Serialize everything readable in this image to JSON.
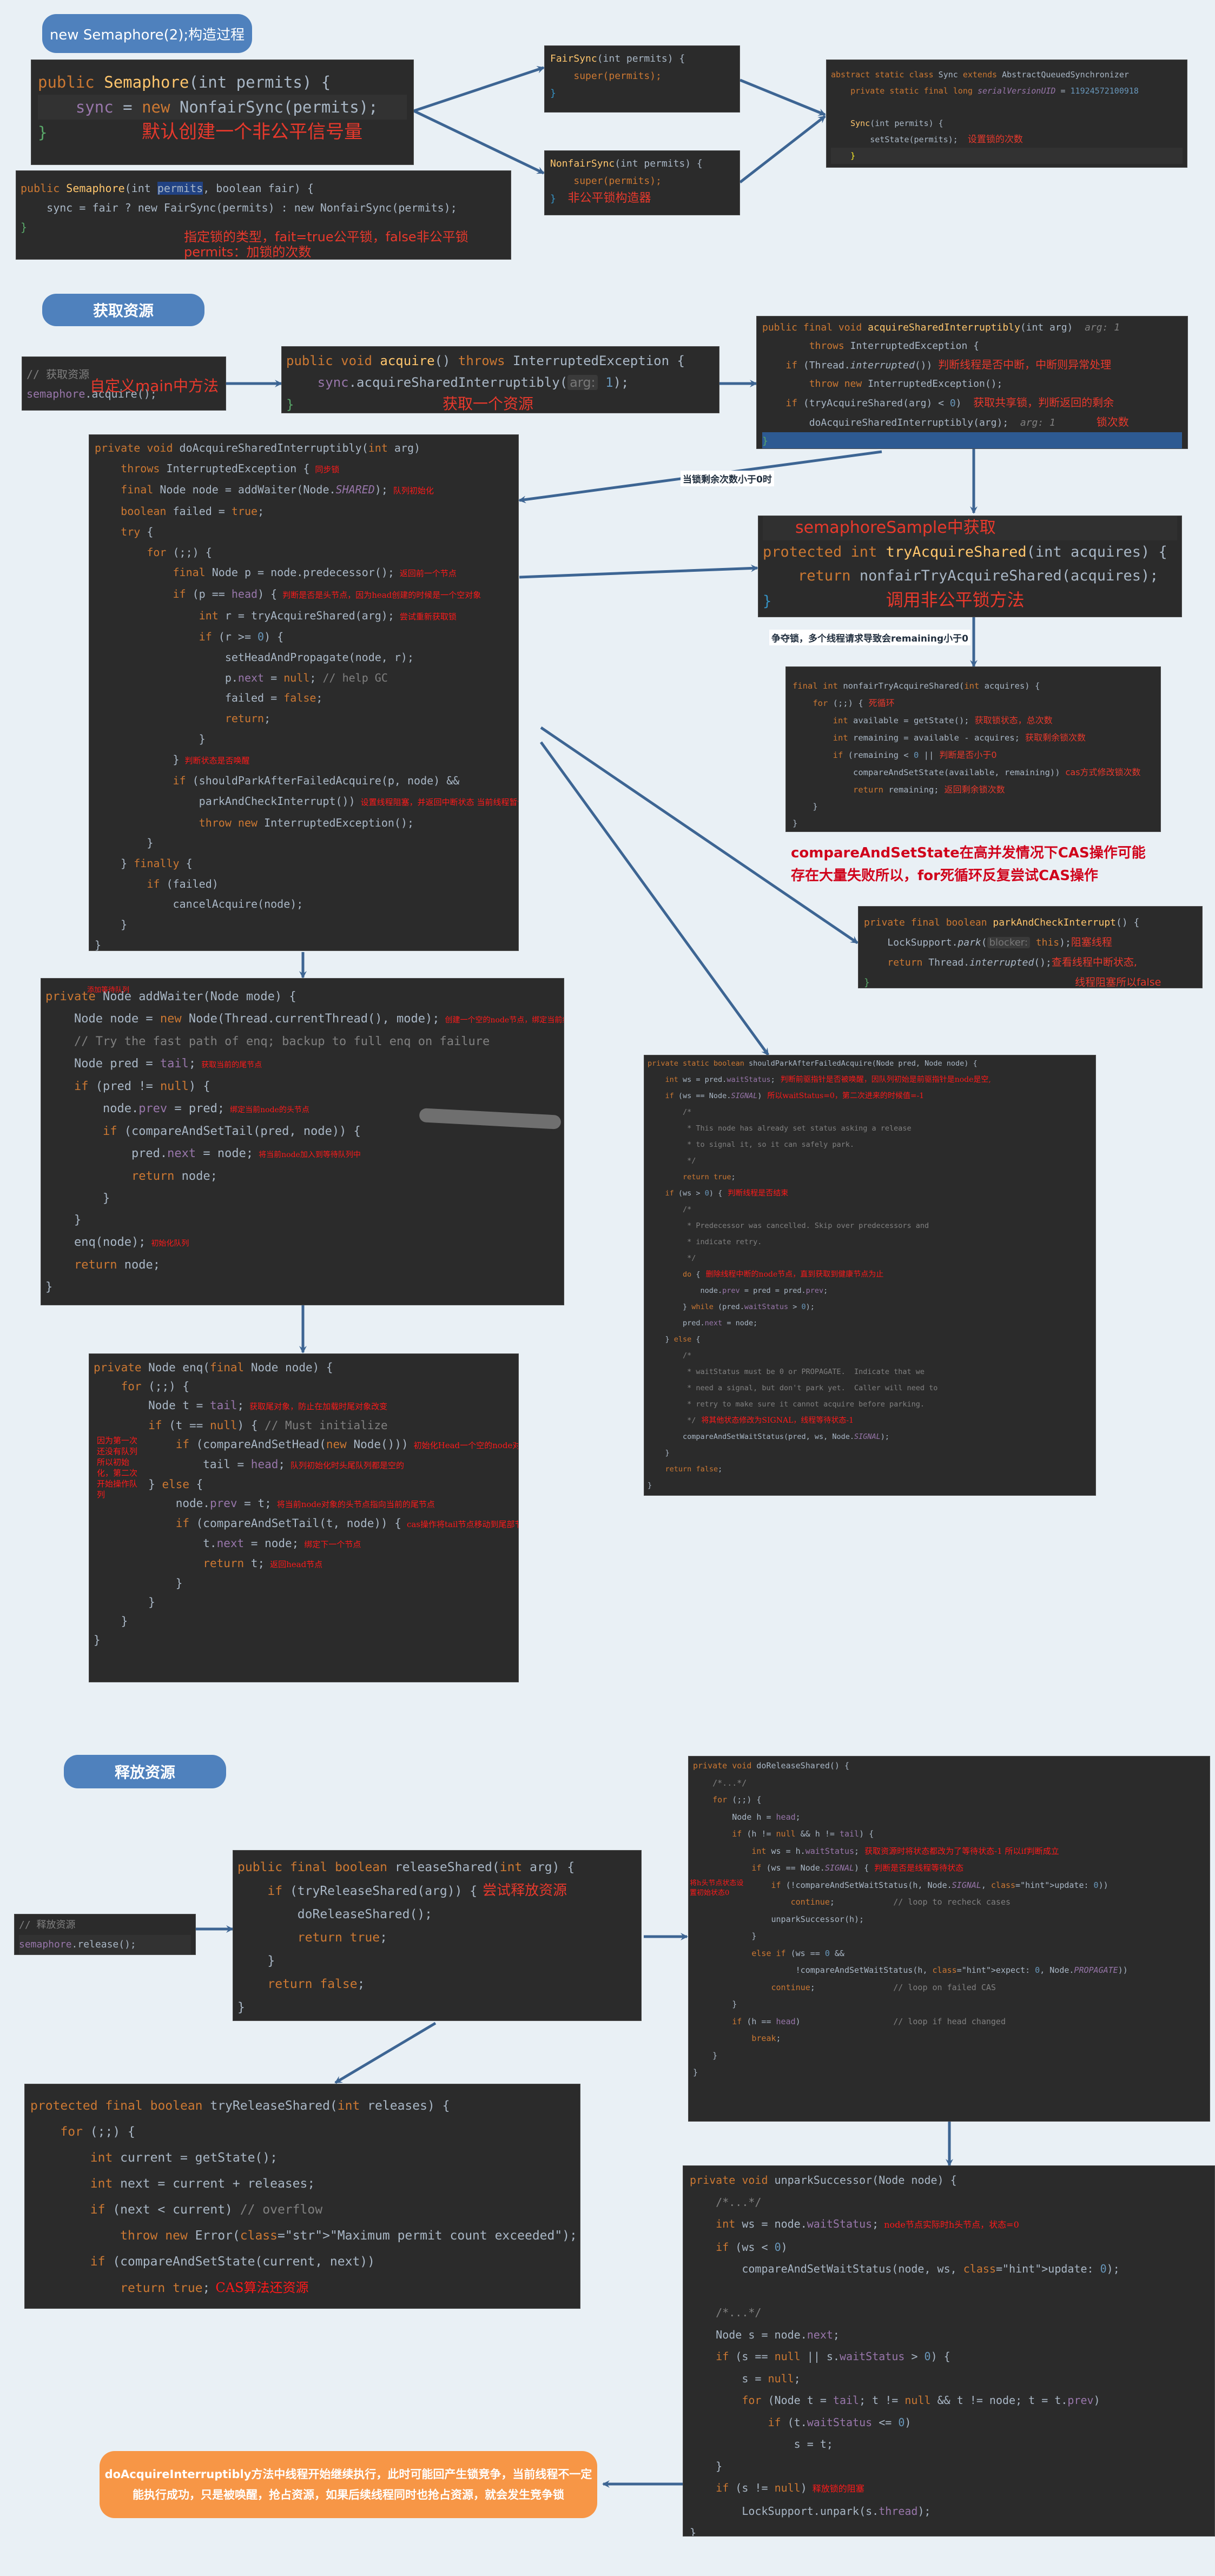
{
  "sections": {
    "construct": "new Semaphore(2);构造过程",
    "acquire": "获取资源",
    "release": "释放资源"
  },
  "ctor1": {
    "l1_kw": "public",
    "l1_fn": "Semaphore",
    "l1_rest": "(int permits) {",
    "l2_var": "sync",
    "l2_op": " = ",
    "l2_kw": "new",
    "l2_call": " NonfairSync(permits);",
    "l3": "}",
    "note": "默认创建一个非公平信号量"
  },
  "ctor2": {
    "l1_kw": "public",
    "l1_fn": "Semaphore",
    "l1_a": "(int ",
    "l1_hl": "permits",
    "l1_b": ", boolean fair) {",
    "l2": "sync = fair ? new FairSync(permits) : new NonfairSync(permits);",
    "l3": "}",
    "note1": "指定锁的类型，fait=true公平锁，false非公平锁",
    "note2": "permits：加锁的次数"
  },
  "fairSync": {
    "l1_fn": "FairSync",
    "l1_rest": "(int permits) {",
    "l2": "super(permits);",
    "l3": "}"
  },
  "nonfairSync": {
    "l1_fn": "NonfairSync",
    "l1_rest": "(int permits) {",
    "l2": "super(permits);",
    "l3": "}",
    "note": "非公平锁构造器"
  },
  "syncClass": {
    "l1_kw": "abstract static class",
    "l1_name": " Sync ",
    "l1_ext": "extends",
    "l1_base": " AbstractQueuedSynchronizer",
    "l2_kw": "private static final long ",
    "l2_f": "serialVersionUID",
    "l2_eq": " = ",
    "l2_num": "11924572100918",
    "l4_fn": "Sync",
    "l4_rest": "(int permits) {",
    "l5": "setState(permits);",
    "l5_note": "设置锁的次数",
    "l6": "}"
  },
  "mainAcquire": {
    "comment": "// 获取资源",
    "overlay": "自定义main中方法",
    "call_obj": "semaphore",
    "call": ".acquire();"
  },
  "acquire": {
    "l1_kw": "public void ",
    "l1_fn": "acquire",
    "l1_rest": "() ",
    "l1_kw2": "throws",
    "l1_exc": " InterruptedException {",
    "l2_obj": "sync",
    "l2_call": ".acquireSharedInterruptibly(",
    "l2_hint": "arg:",
    "l2_num": "1",
    "l2_end": ");",
    "l3": "}",
    "note": "获取一个资源"
  },
  "acqShared": {
    "l1_kw": "public final void ",
    "l1_fn": "acquireSharedInterruptibly",
    "l1_rest": "(int arg)",
    "l1_hint": "arg: 1",
    "l2_kw": "throws",
    "l2_rest": " InterruptedException {",
    "l3_kw": "if",
    "l3_rest": " (Thread.",
    "l3_it": "interrupted",
    "l3_end": "())",
    "l3_note": "判断线程是否中断，中断则异常处理",
    "l4_kw": "throw new",
    "l4_rest": " InterruptedException();",
    "l5_kw": "if",
    "l5_rest": " (tryAcquireShared(arg) < ",
    "l5_num": "0",
    "l5_end": ")",
    "l5_note": "获取共享锁，判断返回的剩余",
    "l6": "doAcquireSharedInterruptibly(arg);",
    "l6_hint": "arg: 1",
    "l6_note": "锁次数",
    "l7": "}"
  },
  "edgeLabels": {
    "lessThanZero": "当锁剩余次数小于0时",
    "contention": "争夺锁，多个线程请求导致会remaining小于0"
  },
  "doAcquire": {
    "lines": [
      {
        "t": "private void doAcquireSharedInterruptibly(int arg)"
      },
      {
        "t": "    throws InterruptedException {",
        "n": "同步锁"
      },
      {
        "t": "    final Node node = addWaiter(Node.SHARED);",
        "n": "队列初始化"
      },
      {
        "t": "    boolean failed = true;"
      },
      {
        "t": "    try {"
      },
      {
        "t": "        for (;;) {"
      },
      {
        "t": "            final Node p = node.predecessor();",
        "n": "返回前一个节点"
      },
      {
        "t": "            if (p == head) {",
        "n": "判断是否是头节点，因为head创建的时候是一个空对象"
      },
      {
        "t": "                int r = tryAcquireShared(arg);",
        "n": "尝试重新获取锁"
      },
      {
        "t": "                if (r >= 0) {"
      },
      {
        "t": "                    setHeadAndPropagate(node, r);"
      },
      {
        "t": "                    p.next = null; // help GC"
      },
      {
        "t": "                    failed = false;"
      },
      {
        "t": "                    return;"
      },
      {
        "t": "                }"
      },
      {
        "t": "            }",
        "n": "判断状态是否唤醒"
      },
      {
        "t": "            if (shouldParkAfterFailedAcquire(p, node) &&"
      },
      {
        "t": "                parkAndCheckInterrupt())",
        "n": "设置线程阻塞，并返回中断状态 当前线程暂停，这个for循环停止，不占用cpu资源"
      },
      {
        "t": "                throw new InterruptedException();"
      },
      {
        "t": "        }"
      },
      {
        "t": "    } finally {"
      },
      {
        "t": "        if (failed)"
      },
      {
        "t": "            cancelAcquire(node);"
      },
      {
        "t": "    }"
      },
      {
        "t": "}"
      }
    ]
  },
  "tryAcq": {
    "header_note": "semaphoreSample中获取",
    "l1_kw": "protected int ",
    "l1_fn": "tryAcquireShared",
    "l1_rest": "(int acquires) {",
    "l2_kw": "return",
    "l2_rest": " nonfairTryAcquireShared(acquires);",
    "l3": "}",
    "note": "调用非公平锁方法"
  },
  "nonfairTry": {
    "lines": [
      {
        "t": "final int nonfairTryAcquireShared(int acquires) {"
      },
      {
        "t": "    for (;;) {",
        "n": "死循环"
      },
      {
        "t": "        int available = getState();",
        "n": "获取锁状态，总次数"
      },
      {
        "t": "        int remaining = available - acquires;",
        "n": "获取剩余锁次数"
      },
      {
        "t": "        if (remaining < 0 ||",
        "n": "判断是否小于0"
      },
      {
        "t": "            compareAndSetState(available, remaining))",
        "n": "cas方式修改锁次数"
      },
      {
        "t": "            return remaining;",
        "n": "返回剩余锁次数"
      },
      {
        "t": "    }"
      },
      {
        "t": "}"
      }
    ],
    "bottom_note1": "compareAndSetState在高并发情况下CAS操作可能",
    "bottom_note2": "存在大量失败所以，for死循环反复尝试CAS操作"
  },
  "parkCheck": {
    "l1_kw": "private final boolean ",
    "l1_fn": "parkAndCheckInterrupt",
    "l1_rest": "() {",
    "l2_a": "LockSupport.",
    "l2_it": "park",
    "l2_b": "(",
    "l2_hint": "blocker:",
    "l2_kw": " this",
    "l2_end": ");",
    "l2_note": "阻塞线程",
    "l3_kw": "return",
    "l3_a": " Thread.",
    "l3_it": "interrupted",
    "l3_end": "();",
    "l3_note1": "查看线程中断状态,",
    "l3_note2": "线程阻塞所以false",
    "l4": "}"
  },
  "addWaiter": {
    "title_note": "添加等待队列",
    "lines": [
      {
        "t": "private Node addWaiter(Node mode) {"
      },
      {
        "t": "    Node node = new Node(Thread.currentThread(), mode);",
        "n": "创建一个空的node节点，绑定当前线程"
      },
      {
        "t": "    // Try the fast path of enq; backup to full enq on failure"
      },
      {
        "t": "    Node pred = tail;",
        "n": "获取当前的尾节点"
      },
      {
        "t": "    if (pred != null) {"
      },
      {
        "t": "        node.prev = pred;",
        "n": "绑定当前node的头节点"
      },
      {
        "t": "        if (compareAndSetTail(pred, node)) {"
      },
      {
        "t": "            pred.next = node;",
        "n": "将当前node加入到等待队列中"
      },
      {
        "t": "            return node;"
      },
      {
        "t": "        }"
      },
      {
        "t": "    }"
      },
      {
        "t": "    enq(node);",
        "n": "初始化队列"
      },
      {
        "t": "    return node;"
      },
      {
        "t": "}"
      }
    ]
  },
  "shouldPark": {
    "lines": [
      {
        "t": "private static boolean shouldParkAfterFailedAcquire(Node pred, Node node) {"
      },
      {
        "t": "    int ws = pred.waitStatus;",
        "n": "判断前驱指针是否被唤醒，因队列初始是前驱指针是node是空,"
      },
      {
        "t": "    if (ws == Node.SIGNAL)",
        "n": "所以waitStatus=0，第二次进来的时候值=-1"
      },
      {
        "t": "        /*"
      },
      {
        "t": "         * This node has already set status asking a release"
      },
      {
        "t": "         * to signal it, so it can safely park."
      },
      {
        "t": "         */"
      },
      {
        "t": "        return true;"
      },
      {
        "t": "    if (ws > 0) {",
        "n": "判断线程是否结束"
      },
      {
        "t": "        /*"
      },
      {
        "t": "         * Predecessor was cancelled. Skip over predecessors and"
      },
      {
        "t": "         * indicate retry."
      },
      {
        "t": "         */"
      },
      {
        "t": "        do {",
        "n": "删除线程中断的node节点，直到获取到健康节点为止"
      },
      {
        "t": "            node.prev = pred = pred.prev;"
      },
      {
        "t": "        } while (pred.waitStatus > 0);"
      },
      {
        "t": "        pred.next = node;"
      },
      {
        "t": "    } else {"
      },
      {
        "t": "        /*"
      },
      {
        "t": "         * waitStatus must be 0 or PROPAGATE.  Indicate that we"
      },
      {
        "t": "         * need a signal, but don't park yet.  Caller will need to"
      },
      {
        "t": "         * retry to make sure it cannot acquire before parking."
      },
      {
        "t": "         */",
        "n": "将其他状态修改为SIGNAL，线程等待状态-1"
      },
      {
        "t": "        compareAndSetWaitStatus(pred, ws, Node.SIGNAL);"
      },
      {
        "t": "    }"
      },
      {
        "t": "    return false;"
      },
      {
        "t": "}"
      }
    ]
  },
  "enq": {
    "side_note": "因为第一次还没有队列所以初始化，第二次开始操作队列",
    "lines": [
      {
        "t": "private Node enq(final Node node) {"
      },
      {
        "t": "    for (;;) {"
      },
      {
        "t": "        Node t = tail;",
        "n": "获取尾对象，防止在加载时尾对象改变"
      },
      {
        "t": "        if (t == null) { // Must initialize"
      },
      {
        "t": "            if (compareAndSetHead(new Node()))",
        "n": "初始化Head一个空的node对象"
      },
      {
        "t": "                tail = head;",
        "n": "队列初始化时头尾队列都是空的"
      },
      {
        "t": "        } else {"
      },
      {
        "t": "            node.prev = t;",
        "n": "将当前node对象的头节点指向当前的尾节点"
      },
      {
        "t": "            if (compareAndSetTail(t, node)) {",
        "n": "cas操作将tail节点移动到尾部节点上"
      },
      {
        "t": "                t.next = node;",
        "n": "绑定下一个节点"
      },
      {
        "t": "                return t;",
        "n": "返回head节点"
      },
      {
        "t": "            }"
      },
      {
        "t": "        }"
      },
      {
        "t": "    }"
      },
      {
        "t": "}"
      }
    ]
  },
  "mainRelease": {
    "comment": "// 释放资源",
    "call_obj": "semaphore",
    "call": ".release();"
  },
  "releaseShared": {
    "lines": [
      {
        "t": "public final boolean releaseShared(int arg) {"
      },
      {
        "t": "    if (tryReleaseShared(arg)) {",
        "n": "尝试释放资源"
      },
      {
        "t": "        doReleaseShared();"
      },
      {
        "t": "        return true;"
      },
      {
        "t": "    }"
      },
      {
        "t": "    return false;"
      },
      {
        "t": "}"
      }
    ]
  },
  "doRelease": {
    "side_note": "将h头节点状态设置初始状态0",
    "lines": [
      {
        "t": "private void doReleaseShared() {"
      },
      {
        "t": "    /*...*/"
      },
      {
        "t": "    for (;;) {"
      },
      {
        "t": "        Node h = head;"
      },
      {
        "t": "        if (h != null && h != tail) {"
      },
      {
        "t": "            int ws = h.waitStatus;",
        "n": "获取资源时将状态都改为了等待状态-1 所以if判断成立"
      },
      {
        "t": "            if (ws == Node.SIGNAL) {",
        "n": "判断是否是线程等待状态"
      },
      {
        "t": "                if (!compareAndSetWaitStatus(h, Node.SIGNAL, update: 0))"
      },
      {
        "t": "                    continue;            // loop to recheck cases"
      },
      {
        "t": "                unparkSuccessor(h);"
      },
      {
        "t": "            }"
      },
      {
        "t": "            else if (ws == 0 &&"
      },
      {
        "t": "                     !compareAndSetWaitStatus(h, expect: 0, Node.PROPAGATE))"
      },
      {
        "t": "                continue;                // loop on failed CAS"
      },
      {
        "t": "        }"
      },
      {
        "t": "        if (h == head)                   // loop if head changed"
      },
      {
        "t": "            break;"
      },
      {
        "t": "    }"
      },
      {
        "t": "}"
      }
    ]
  },
  "tryRelease": {
    "lines": [
      {
        "t": "protected final boolean tryReleaseShared(int releases) {"
      },
      {
        "t": "    for (;;) {"
      },
      {
        "t": "        int current = getState();"
      },
      {
        "t": "        int next = current + releases;"
      },
      {
        "t": "        if (next < current) // overflow"
      },
      {
        "t": "            throw new Error(\"Maximum permit count exceeded\");"
      },
      {
        "t": "        if (compareAndSetState(current, next))"
      },
      {
        "t": "            return true;",
        "n": "CAS算法还资源"
      },
      {
        "t": "    }"
      },
      {
        "t": "}"
      }
    ]
  },
  "unpark": {
    "lines": [
      {
        "t": "private void unparkSuccessor(Node node) {"
      },
      {
        "t": "    /*...*/"
      },
      {
        "t": "    int ws = node.waitStatus;",
        "n": "node节点实际时h头节点，状态=0"
      },
      {
        "t": "    if (ws < 0)"
      },
      {
        "t": "        compareAndSetWaitStatus(node, ws, update: 0);"
      },
      {
        "t": ""
      },
      {
        "t": "    /*...*/"
      },
      {
        "t": "    Node s = node.next;"
      },
      {
        "t": "    if (s == null || s.waitStatus > 0) {"
      },
      {
        "t": "        s = null;"
      },
      {
        "t": "        for (Node t = tail; t != null && t != node; t = t.prev)"
      },
      {
        "t": "            if (t.waitStatus <= 0)"
      },
      {
        "t": "                s = t;"
      },
      {
        "t": "    }"
      },
      {
        "t": "    if (s != null)",
        "n": "释放锁的阻塞"
      },
      {
        "t": "        LockSupport.unpark(s.thread);"
      },
      {
        "t": "}"
      }
    ]
  },
  "finalNote": "doAcquireInterruptibly方法中线程开始继续执行，此时可能回产生锁竞争，当前线程不一定能执行成功，只是被唤醒，抢占资源，如果后续线程同时也抢占资源，就会发生竞争锁"
}
